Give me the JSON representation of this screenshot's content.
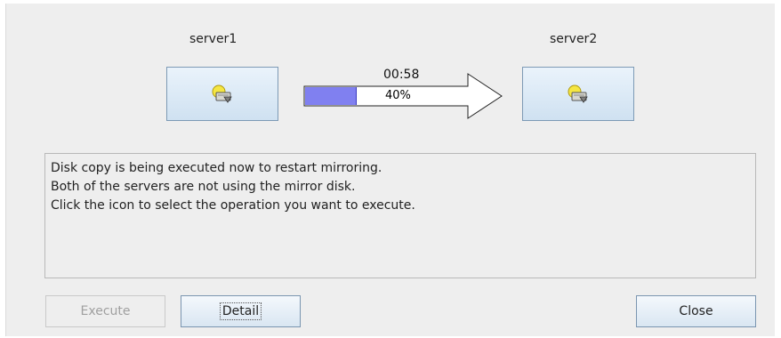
{
  "servers": [
    {
      "name": "server1",
      "icon": "hdd-warning-icon"
    },
    {
      "name": "server2",
      "icon": "hdd-warning-icon"
    }
  ],
  "copy": {
    "time_remaining": "00:58",
    "progress_text": "40%",
    "progress": 0.4,
    "fill_color": "#8080f0"
  },
  "message": {
    "lines": [
      "Disk copy is being executed now to restart mirroring.",
      "Both of the servers are not using the mirror disk.",
      "Click the icon to select the operation you want to execute."
    ]
  },
  "buttons": {
    "execute": "Execute",
    "detail": "Detail",
    "close": "Close"
  }
}
